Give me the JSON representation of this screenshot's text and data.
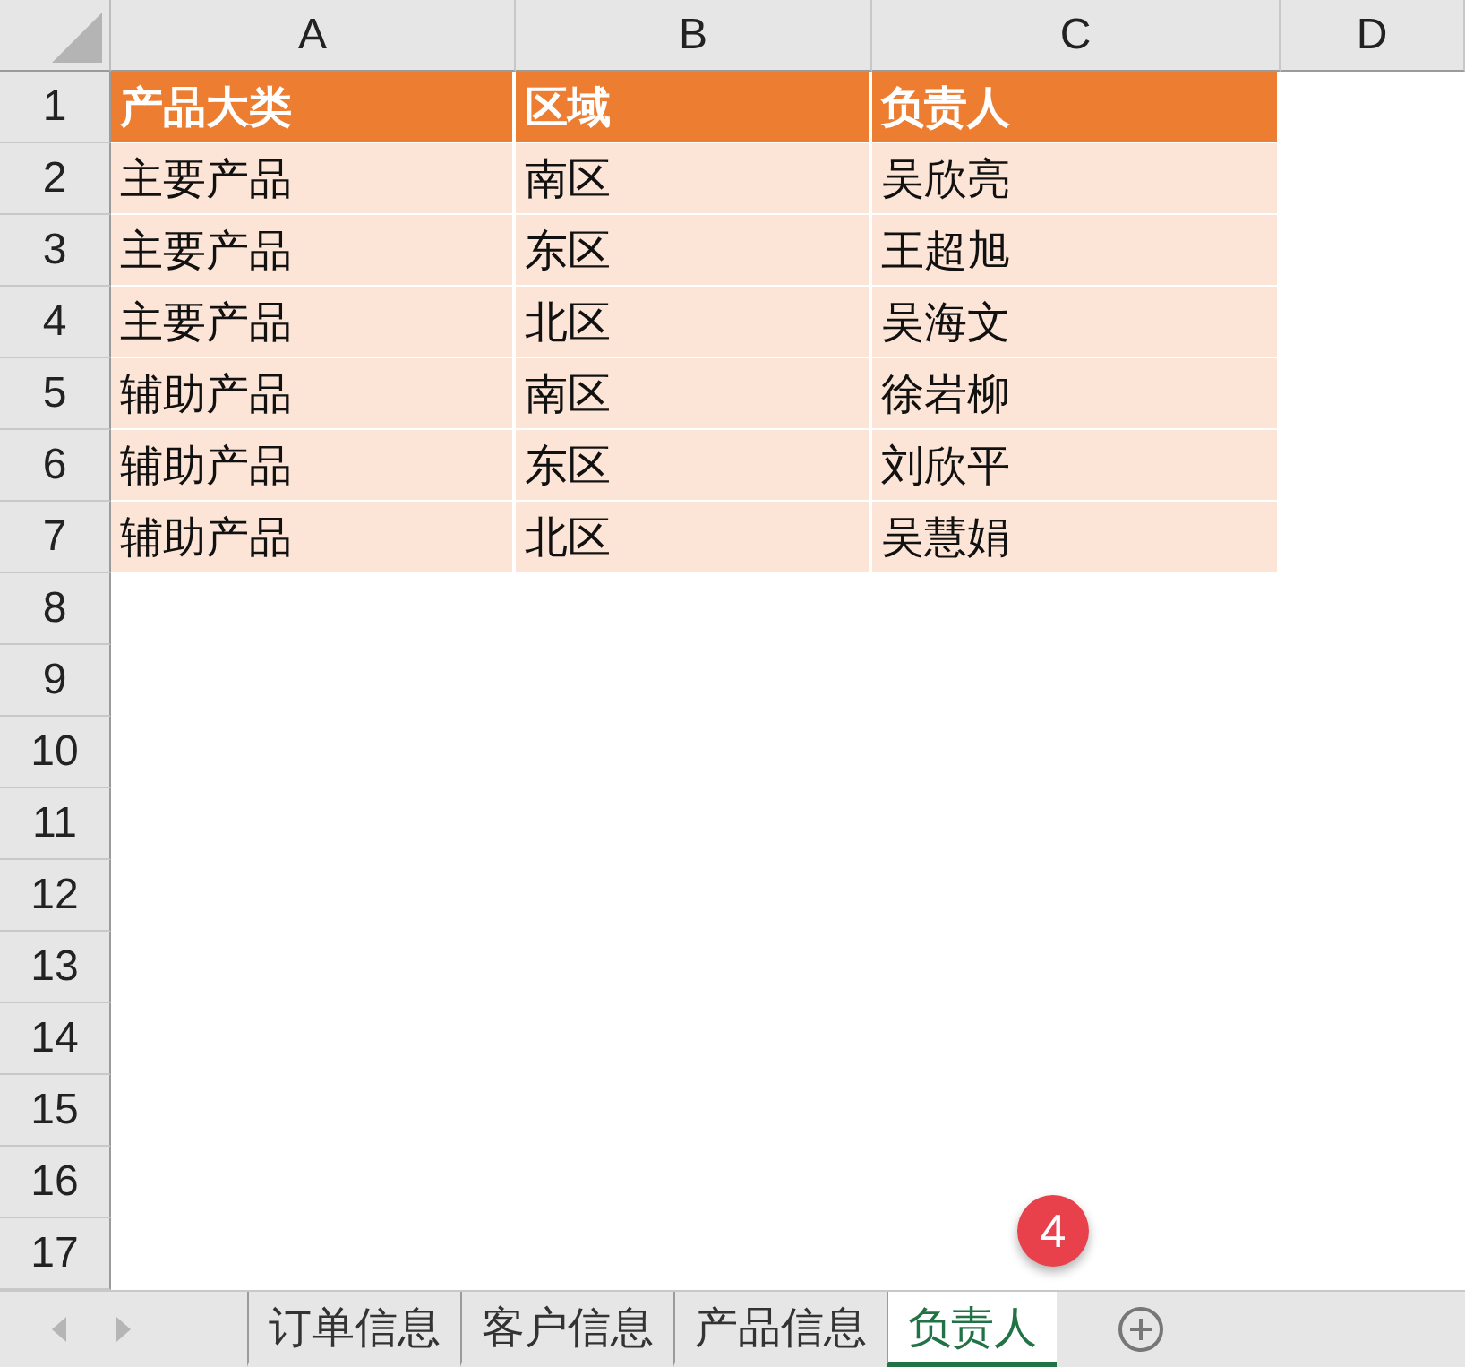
{
  "columns": [
    "A",
    "B",
    "C",
    "D"
  ],
  "row_numbers": [
    "1",
    "2",
    "3",
    "4",
    "5",
    "6",
    "7",
    "8",
    "9",
    "10",
    "11",
    "12",
    "13",
    "14",
    "15",
    "16",
    "17"
  ],
  "rows": [
    {
      "kind": "header",
      "cells": [
        "产品大类",
        "区域",
        "负责人"
      ]
    },
    {
      "kind": "data",
      "cells": [
        "主要产品",
        "南区",
        "吴欣亮"
      ]
    },
    {
      "kind": "data",
      "cells": [
        "主要产品",
        "东区",
        "王超旭"
      ]
    },
    {
      "kind": "data",
      "cells": [
        "主要产品",
        "北区",
        "吴海文"
      ]
    },
    {
      "kind": "data",
      "cells": [
        "辅助产品",
        "南区",
        "徐岩柳"
      ]
    },
    {
      "kind": "data",
      "cells": [
        "辅助产品",
        "东区",
        "刘欣平"
      ]
    },
    {
      "kind": "data",
      "cells": [
        "辅助产品",
        "北区",
        "吴慧娟"
      ]
    }
  ],
  "sheet_tabs": [
    {
      "label": "订单信息",
      "selected": false
    },
    {
      "label": "客户信息",
      "selected": false
    },
    {
      "label": "产品信息",
      "selected": false
    },
    {
      "label": "负责人",
      "selected": true
    }
  ],
  "step_badge": "4"
}
